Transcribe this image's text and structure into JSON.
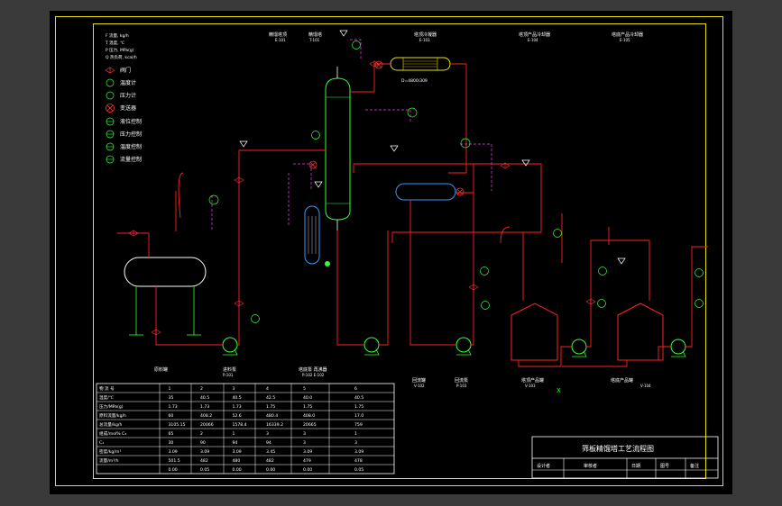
{
  "legend": {
    "symbols": [
      "F 流量, kg/h",
      "T 温度, ℃",
      "P 压力, MPa(g)",
      "Q 热负荷, kcal/h"
    ],
    "items": [
      {
        "label": "阀门",
        "icon": "valve-icon"
      },
      {
        "label": "温度计",
        "icon": "thermometer-icon"
      },
      {
        "label": "压力计",
        "icon": "pressure-gauge-icon"
      },
      {
        "label": "变送器",
        "icon": "transmitter-icon"
      },
      {
        "label": "液位控制",
        "icon": "level-control-icon"
      },
      {
        "label": "压力控制",
        "icon": "pressure-control-icon"
      },
      {
        "label": "温度控制",
        "icon": "temperature-control-icon"
      },
      {
        "label": "流量控制",
        "icon": "flow-control-icon"
      }
    ]
  },
  "equipment_labels": {
    "top": [
      {
        "name": "精馏塔顶",
        "tag": "E-101"
      },
      {
        "name": "精馏塔",
        "tag": "T-101"
      },
      {
        "name": "塔顶冷凝器",
        "tag": "E-103"
      },
      {
        "name": "塔顶产品冷却器",
        "tag": "E-104"
      },
      {
        "name": "塔底产品冷却器",
        "tag": "E-105"
      }
    ],
    "bottom": [
      {
        "name": "原料罐",
        "tag": ""
      },
      {
        "name": "进料泵",
        "tag": "P-101"
      },
      {
        "name": "塔底泵 再沸器",
        "tag": "P-102 E-102"
      },
      {
        "name": "回流罐",
        "tag": "V-102"
      },
      {
        "name": "回流泵",
        "tag": "P-103"
      },
      {
        "name": "塔顶产品罐",
        "tag": "V-103"
      },
      {
        "name": "塔底产品罐",
        "tag": "V-104"
      }
    ],
    "condenser_tag": "D=4800/309"
  },
  "stream_table": {
    "header": [
      "物 流 号",
      "1",
      "2",
      "3",
      "4",
      "5",
      "6"
    ],
    "rows": [
      [
        "温度/℃",
        "35",
        "40.5",
        "40.5",
        "42.5",
        "40.0",
        "40.5"
      ],
      [
        "压力/MPa(g)",
        "1.73",
        "1.73",
        "1.73",
        "1.75",
        "1.75",
        "1.75"
      ],
      [
        "原料流量/kg/h",
        "60",
        "408.2",
        "52.6",
        "480.4",
        "408.0",
        "17.0"
      ],
      [
        "总流量/kg/h",
        "3105.15",
        "20066",
        "1578.4",
        "16339.2",
        "20665",
        "759"
      ],
      [
        "组成/mol%  C₃",
        "65",
        "2",
        "1",
        "3",
        "3",
        "1"
      ],
      [
        "C₄",
        "30",
        "90",
        "94",
        "94",
        "3",
        "3"
      ],
      [
        "密度/kg/m³",
        "3.09",
        "3.09",
        "3.09",
        "3.45",
        "3.09",
        "3.09"
      ],
      [
        "流量/m³/h",
        "501.5",
        "482",
        "480",
        "482",
        "479",
        "478"
      ],
      [
        "",
        "0.00",
        "0.05",
        "0.00",
        "0.00",
        "0.00",
        "0.05"
      ]
    ]
  },
  "title_block": {
    "title": "筛板精馏塔工艺流程图",
    "cells": [
      "设计者",
      "审核者",
      "日期",
      "图号",
      "备注"
    ]
  },
  "mark_x": "X"
}
